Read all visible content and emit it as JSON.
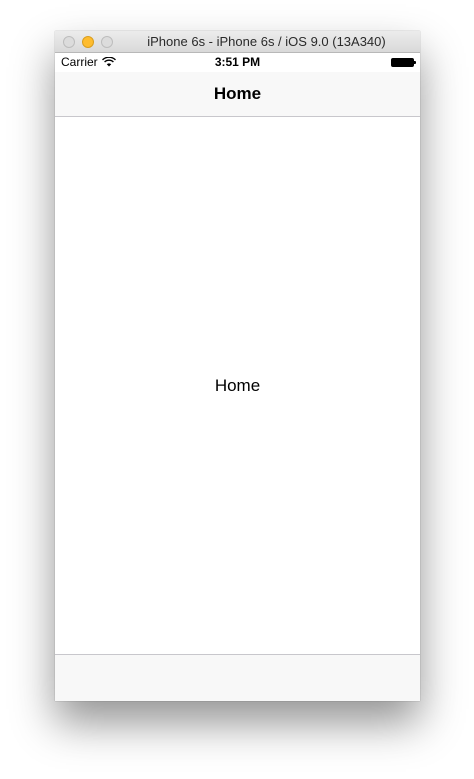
{
  "window": {
    "title": "iPhone 6s - iPhone 6s / iOS 9.0 (13A340)"
  },
  "status_bar": {
    "carrier": "Carrier",
    "time": "3:51 PM"
  },
  "nav_bar": {
    "title": "Home"
  },
  "main": {
    "label": "Home"
  },
  "colors": {
    "bar_background": "#f8f8f8",
    "separator": "#c8c7cc",
    "minimize_light": "#febc2e"
  }
}
